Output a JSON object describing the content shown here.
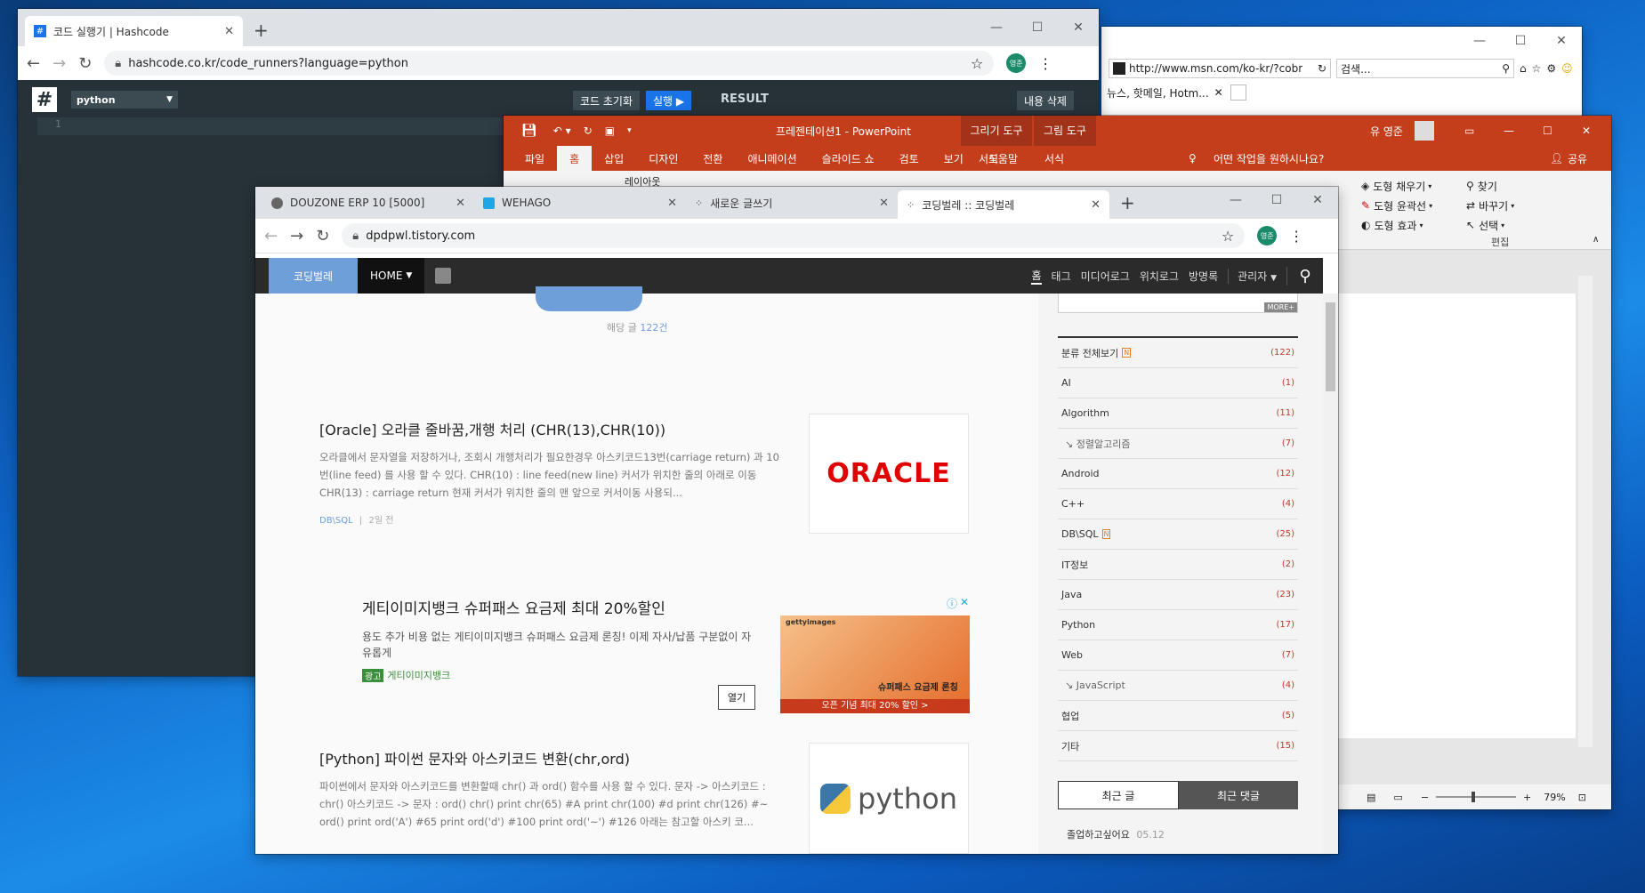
{
  "colors": {
    "ppt_accent": "#c43e1c",
    "blog_nav": "#2b2b2b",
    "blog_brand": "#6f9fd8",
    "hashcode_bg": "#263238"
  },
  "hashcode": {
    "tab_title": "코드 실행기 | Hashcode",
    "url": "hashcode.co.kr/code_runners?language=python",
    "language": "python",
    "reset_label": "코드 초기화",
    "run_label": "실행 ▶",
    "result_label": "RESULT",
    "clear_label": "내용 삭제",
    "line_no": "1",
    "avatar": "영준"
  },
  "ie": {
    "url": "http://www.msn.com/ko-kr/?cobr",
    "search_placeholder": "검색...",
    "tab_label": "뉴스, 핫메일, Hotm..."
  },
  "ppt": {
    "title": "프레젠테이션1 - PowerPoint",
    "context_tool1": "그리기 도구",
    "context_tool2": "그림 도구",
    "user": "유 영준",
    "tabs": [
      "파일",
      "홈",
      "삽입",
      "디자인",
      "전환",
      "애니메이션",
      "슬라이드 쇼",
      "검토",
      "보기",
      "도움말"
    ],
    "format1": "서식",
    "format2": "서식",
    "tell_me": "어떤 작업을 원하시나요?",
    "share": "공유",
    "shape_fill": "도형 채우기",
    "shape_outline": "도형 윤곽선",
    "shape_effect": "도형 효과",
    "find": "찾기",
    "replace": "바꾸기",
    "select": "선택",
    "edit_group": "편집",
    "layout": "레이아웃",
    "zoom": "79%"
  },
  "blog_browser": {
    "tabs": [
      {
        "label": "DOUZONE ERP 10 [5000]"
      },
      {
        "label": "WEHAGO"
      },
      {
        "label": "새로운 글쓰기"
      },
      {
        "label": "코딩벌레 :: 코딩벌레"
      }
    ],
    "url": "dpdpwl.tistory.com",
    "avatar": "영준"
  },
  "blog": {
    "brand": "코딩벌레",
    "home": "HOME",
    "nav": [
      "홈",
      "태그",
      "미디어로그",
      "위치로그",
      "방명록"
    ],
    "admin": "관리자",
    "count_prefix": "해당 글 ",
    "count_value": "122건",
    "posts": [
      {
        "title": "[Oracle] 오라클 줄바꿈,개행 처리 (CHR(13),CHR(10))",
        "excerpt": "오라클에서 문자열을 저장하거나, 조회시 개행처리가 필요한경우 아스키코드13번(carriage return) 과 10번(line feed) 를 사용 할 수 있다. CHR(10) : line feed(new line) 커서가 위치한 줄의 아래로 이동 CHR(13) : carriage return 현재 커서가 위치한 줄의 맨 앞으로 커서이동 사용되...",
        "category": "DB\\SQL",
        "date": "2일 전",
        "thumb": "ORACLE"
      },
      {
        "title": "[Python] 파이썬 문자와 아스키코드 변환(chr,ord)",
        "excerpt": "파이썬에서 문자와 아스키코드를 변환할때 chr() 과 ord() 함수를 사용 할 수 있다. 문자 -> 아스키코드 : chr() 아스키코드 -> 문자 : ord() chr() print chr(65) #A print chr(100) #d print chr(126) #~ ord() print ord('A') #65 print ord('d') #100 print ord('~') #126 아래는 참고할 아스키 코...",
        "thumb": "python"
      }
    ],
    "ad": {
      "title": "게티이미지뱅크 슈퍼패스 요금제 최대 20%할인",
      "desc": "용도 추가 비용 없는 게티이미지뱅크 슈퍼패스 요금제 론칭! 이제 자사/납품 구분없이 자유롭게",
      "badge": "광고",
      "advertiser": "게티이미지뱅크",
      "open": "열기",
      "img_text1": "슈퍼패스 요금제 론칭",
      "img_text2": "오픈 기념 최대 20% 할인 >",
      "img_logo": "gettyimages"
    },
    "more": "MORE+",
    "categories": [
      {
        "name": "분류 전체보기",
        "count": "(122)"
      },
      {
        "name": "AI",
        "count": "(1)"
      },
      {
        "name": "Algorithm",
        "count": "(11)"
      },
      {
        "name": "↘ 정렬알고리즘",
        "count": "(7)"
      },
      {
        "name": "Android",
        "count": "(12)"
      },
      {
        "name": "C++",
        "count": "(4)"
      },
      {
        "name": "DB\\SQL",
        "count": "(25)"
      },
      {
        "name": "IT정보",
        "count": "(2)"
      },
      {
        "name": "Java",
        "count": "(23)"
      },
      {
        "name": "Python",
        "count": "(17)"
      },
      {
        "name": "Web",
        "count": "(7)"
      },
      {
        "name": "↘ JavaScript",
        "count": "(4)"
      },
      {
        "name": "협업",
        "count": "(5)"
      },
      {
        "name": "기타",
        "count": "(15)"
      }
    ],
    "recent_posts": "최근 글",
    "recent_comments": "최근 댓글",
    "comment": "졸업하고싶어요",
    "comment_date": "05.12"
  }
}
